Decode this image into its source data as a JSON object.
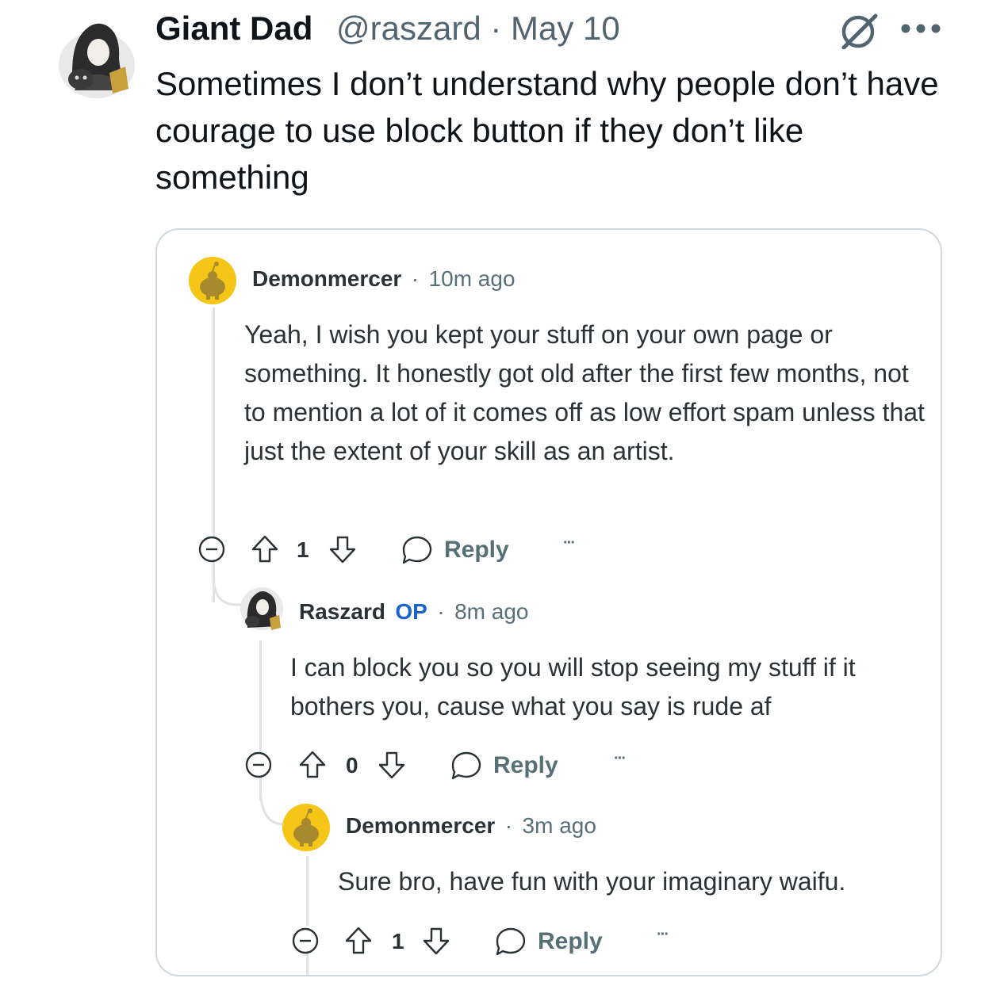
{
  "tweet": {
    "author_name": "Giant Dad",
    "handle_line": "@raszard · May 10",
    "text": "Sometimes I don’t understand why people don’t have courage to use block button if they don’t like something",
    "icons": [
      "grok-icon",
      "more-icon"
    ]
  },
  "comments": [
    {
      "username": "Demonmercer",
      "separator": "·",
      "time": "10m ago",
      "body": "Yeah, I wish you kept your stuff on your own page or something. It honestly got old after the first few months, not to mention a lot of it comes off as low effort spam unless that just the extent of your skill as an artist.",
      "votes": "1",
      "reply_label": "Reply",
      "more_label": "···"
    },
    {
      "username": "Raszard",
      "op_badge": "OP",
      "separator": "·",
      "time": "8m ago",
      "body": "I can block you so you will stop seeing my stuff if it bothers you, cause what you say is rude af",
      "votes": "0",
      "reply_label": "Reply",
      "more_label": "···"
    },
    {
      "username": "Demonmercer",
      "separator": "·",
      "time": "3m ago",
      "body": "Sure bro, have fun with your imaginary waifu.",
      "votes": "1",
      "reply_label": "Reply",
      "more_label": "···"
    }
  ],
  "colors": {
    "text_primary": "#0f1419",
    "text_secondary": "#536471",
    "op_blue": "#1c63ce",
    "snoo_yellow": "#f5c518",
    "card_border": "#cfd9de"
  }
}
